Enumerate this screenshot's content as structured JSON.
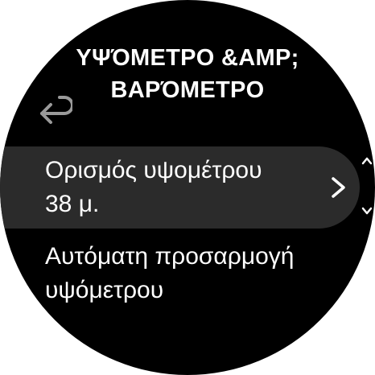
{
  "header": {
    "title_line1": "ΥΨΌΜΕΤΡΟ &AMP;",
    "title_line2": "ΒΑΡΌΜΕΤΡΟ"
  },
  "back": {
    "icon": "back-arrow-icon"
  },
  "menu": {
    "items": [
      {
        "label": "Ορισμός υψομέτρου",
        "value": "38 μ.",
        "selected": true,
        "icon": "chevron-right-icon"
      },
      {
        "label": "Αυτόματη προσαρμογή",
        "label_line2": "υψόμετρου",
        "selected": false
      }
    ]
  },
  "scroll": {
    "up_icon": "chevron-up-icon",
    "down_icon": "chevron-down-icon"
  },
  "colors": {
    "background": "#000000",
    "selected_row": "#2b2b2b",
    "text": "#ffffff",
    "back_icon": "#9a9a9a"
  }
}
